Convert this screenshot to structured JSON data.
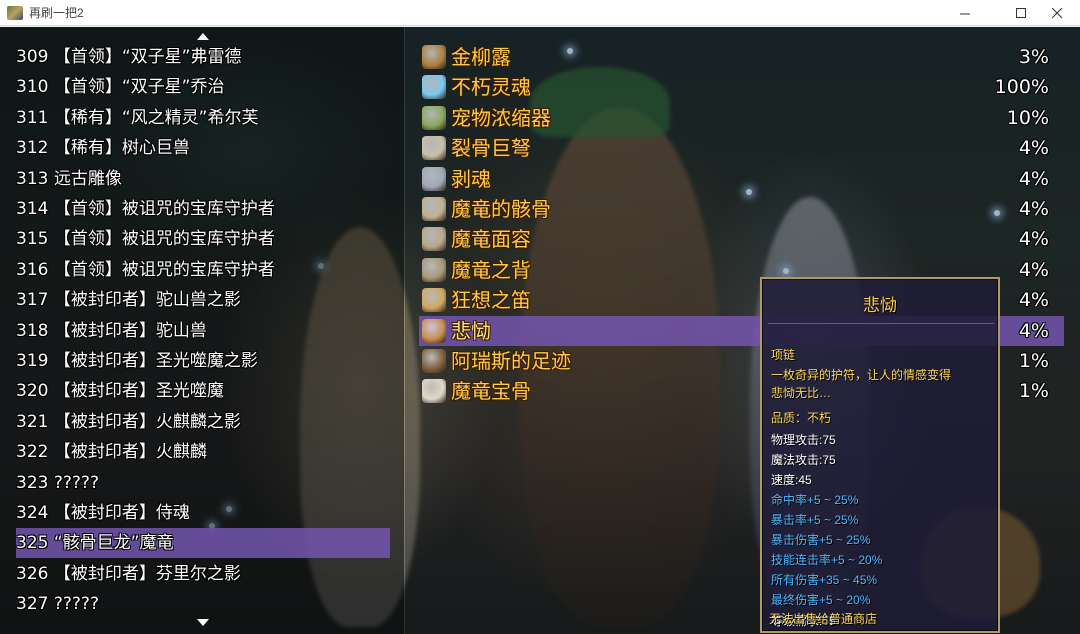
{
  "window": {
    "title": "再刷一把2",
    "icon": "app-icon"
  },
  "monster_list": [
    {
      "text": "309 【首领】“双子星”弗雷德",
      "selected": false
    },
    {
      "text": "310 【首领】“双子星”乔治",
      "selected": false
    },
    {
      "text": "311 【稀有】“风之精灵”希尔芙",
      "selected": false
    },
    {
      "text": "312 【稀有】树心巨兽",
      "selected": false
    },
    {
      "text": "313 远古雕像",
      "selected": false
    },
    {
      "text": "314 【首领】被诅咒的宝库守护者",
      "selected": false
    },
    {
      "text": "315 【首领】被诅咒的宝库守护者",
      "selected": false
    },
    {
      "text": "316 【首领】被诅咒的宝库守护者",
      "selected": false
    },
    {
      "text": "317 【被封印者】驼山兽之影",
      "selected": false
    },
    {
      "text": "318 【被封印者】驼山兽",
      "selected": false
    },
    {
      "text": "319 【被封印者】圣光噬魔之影",
      "selected": false
    },
    {
      "text": "320 【被封印者】圣光噬魔",
      "selected": false
    },
    {
      "text": "321 【被封印者】火麒麟之影",
      "selected": false
    },
    {
      "text": "322 【被封印者】火麒麟",
      "selected": false
    },
    {
      "text": "323 ?????",
      "selected": false
    },
    {
      "text": "324 【被封印者】侍魂",
      "selected": false
    },
    {
      "text": "325 “骸骨巨龙”魔竜",
      "selected": true
    },
    {
      "text": "326 【被封印者】芬里尔之影",
      "selected": false
    },
    {
      "text": "327 ?????",
      "selected": false
    }
  ],
  "drops": [
    {
      "name": "金柳露",
      "rate": "3%",
      "icon": "potion-icon",
      "icon_color": "#b08040",
      "selected": false
    },
    {
      "name": "不朽灵魂",
      "rate": "100%",
      "icon": "crystal-icon",
      "icon_color": "#7ac8f0",
      "selected": false
    },
    {
      "name": "宠物浓缩器",
      "rate": "10%",
      "icon": "pet-device-icon",
      "icon_color": "#8aa860",
      "selected": false
    },
    {
      "name": "裂骨巨弩",
      "rate": "4%",
      "icon": "crossbow-icon",
      "icon_color": "#c8c0a8",
      "selected": false
    },
    {
      "name": "剥魂",
      "rate": "4%",
      "icon": "dagger-icon",
      "icon_color": "#a0a8b8",
      "selected": false
    },
    {
      "name": "魔竜的骸骨",
      "rate": "4%",
      "icon": "bone-armor-icon",
      "icon_color": "#c0b090",
      "selected": false
    },
    {
      "name": "魔竜面容",
      "rate": "4%",
      "icon": "skull-helm-icon",
      "icon_color": "#b8a888",
      "selected": false
    },
    {
      "name": "魔竜之背",
      "rate": "4%",
      "icon": "spine-icon",
      "icon_color": "#a89878",
      "selected": false
    },
    {
      "name": "狂想之笛",
      "rate": "4%",
      "icon": "flute-icon",
      "icon_color": "#d0a860",
      "selected": false
    },
    {
      "name": "悲恸",
      "rate": "4%",
      "icon": "amulet-icon",
      "icon_color": "#c89050",
      "selected": true
    },
    {
      "name": "阿瑞斯的足迹",
      "rate": "1%",
      "icon": "boots-icon",
      "icon_color": "#806040",
      "selected": false
    },
    {
      "name": "魔竜宝骨",
      "rate": "1%",
      "icon": "bone-icon",
      "icon_color": "#e0d8c8",
      "selected": false
    }
  ],
  "tooltip": {
    "title": "悲恸",
    "type": "项链",
    "description_line1": "一枚奇异的护符，让人的情感变得",
    "description_line2": "悲恸无比…",
    "quality": "品质：不朽",
    "stats": [
      "物理攻击:75",
      "魔法攻击:75",
      "速度:45"
    ],
    "bonus_stats": [
      "命中率+5 ~ 25%",
      "暴击率+5 ~ 25%",
      "暴击伤害+5 ~ 25%",
      "技能连击率+5 ~ 20%",
      "所有伤害+35 ~ 45%",
      "最终伤害+5 ~ 20%"
    ],
    "level_requirement": "等级需求:55",
    "sell_note": "无法出售给普通商店"
  },
  "colors": {
    "selection": "#7355af",
    "drop_name": "#ffc94a",
    "bonus_stat": "#4fb8ff",
    "tooltip_border": "#b09a63"
  }
}
